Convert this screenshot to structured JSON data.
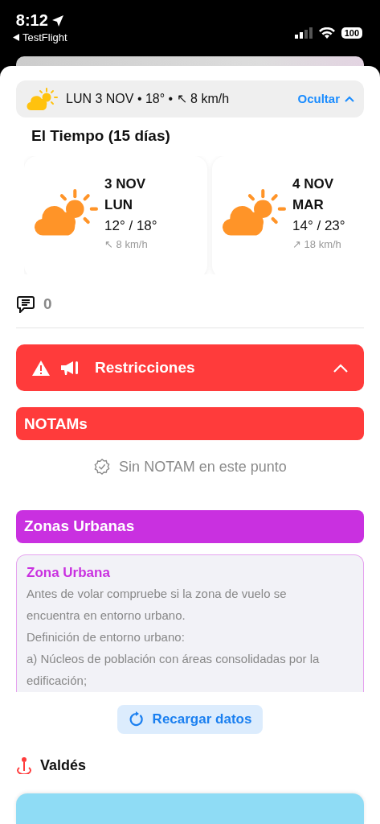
{
  "status_bar": {
    "time": "8:12",
    "back_label": "TestFlight",
    "battery": "100"
  },
  "weather_summary": {
    "text": "LUN 3 NOV • 18° • ↖ 8 km/h",
    "action": "Ocultar",
    "expanded": true
  },
  "forecast": {
    "title": "El Tiempo (15 días)",
    "days": [
      {
        "date": "3 NOV",
        "weekday": "LUN",
        "temps": "12° / 18°",
        "wind": "↖ 8 km/h"
      },
      {
        "date": "4 NOV",
        "weekday": "MAR",
        "temps": "14° / 23°",
        "wind": "↗ 18 km/h"
      }
    ]
  },
  "comments": {
    "count": "0"
  },
  "restrictions": {
    "title": "Restricciones",
    "expanded": true
  },
  "sections": [
    {
      "kind": "empty",
      "title": "NOTAMs",
      "color": "#ff3b3b",
      "message": "Sin NOTAM en este punto"
    },
    {
      "kind": "info",
      "title": "Zonas Urbanas",
      "color": "#c930e0",
      "card_title": "Zona Urbana",
      "paragraphs": [
        "Antes de volar compruebe si la zona de vuelo se encuentra en entorno urbano.",
        "Definición de entorno urbano:",
        "a) Núcleos de población con áreas consolidadas por la edificación;"
      ]
    }
  ],
  "reload_button": {
    "label": "Recargar datos"
  },
  "location": {
    "name": "Valdés"
  }
}
